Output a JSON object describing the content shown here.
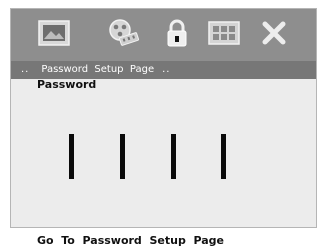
{
  "toolbar": {
    "icons": [
      "general-setup-icon",
      "video-setup-icon",
      "password-lock-icon",
      "preference-grid-icon",
      "exit-icon"
    ]
  },
  "caption": {
    "left_dots": "..",
    "title": "Password  Setup  Page",
    "right_dots": ".."
  },
  "password": {
    "label": "Password",
    "digits": [
      "|",
      "|",
      "|",
      "|"
    ]
  },
  "footer": {
    "hint": "Go  To  Password  Setup  Page"
  }
}
